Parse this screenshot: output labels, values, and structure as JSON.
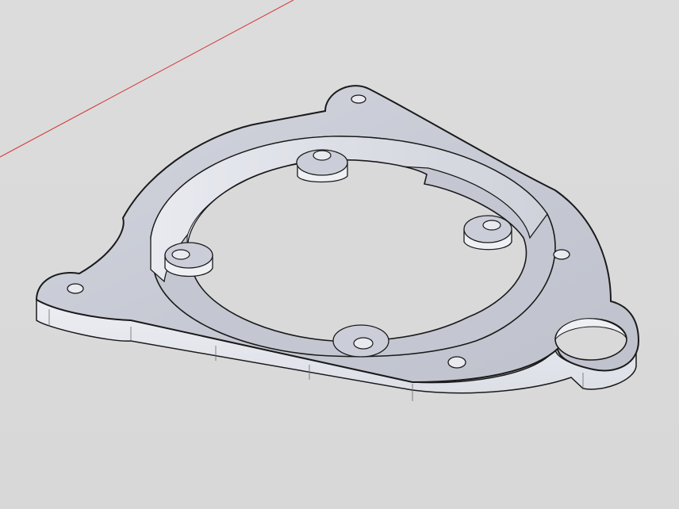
{
  "scene": {
    "background_color": "#d9d9d9",
    "axis_color": "#d23a3a",
    "part_top_color": "#c9ccd6",
    "part_side_color": "#dfe2ea",
    "edge_color": "#1a1a1a"
  }
}
